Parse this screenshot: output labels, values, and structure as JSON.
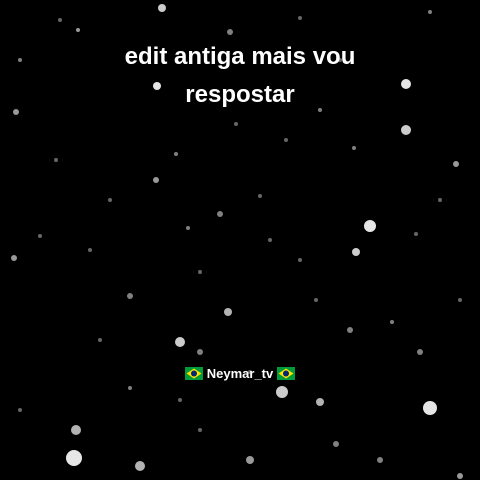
{
  "video": {
    "caption_line1": "edit antiga mais vou",
    "caption_line2": "respostar",
    "watermark_text": "Neymar_tv",
    "watermark_icon": "brazil-flag-icon",
    "background_color": "#000000",
    "text_color": "#ffffff"
  }
}
